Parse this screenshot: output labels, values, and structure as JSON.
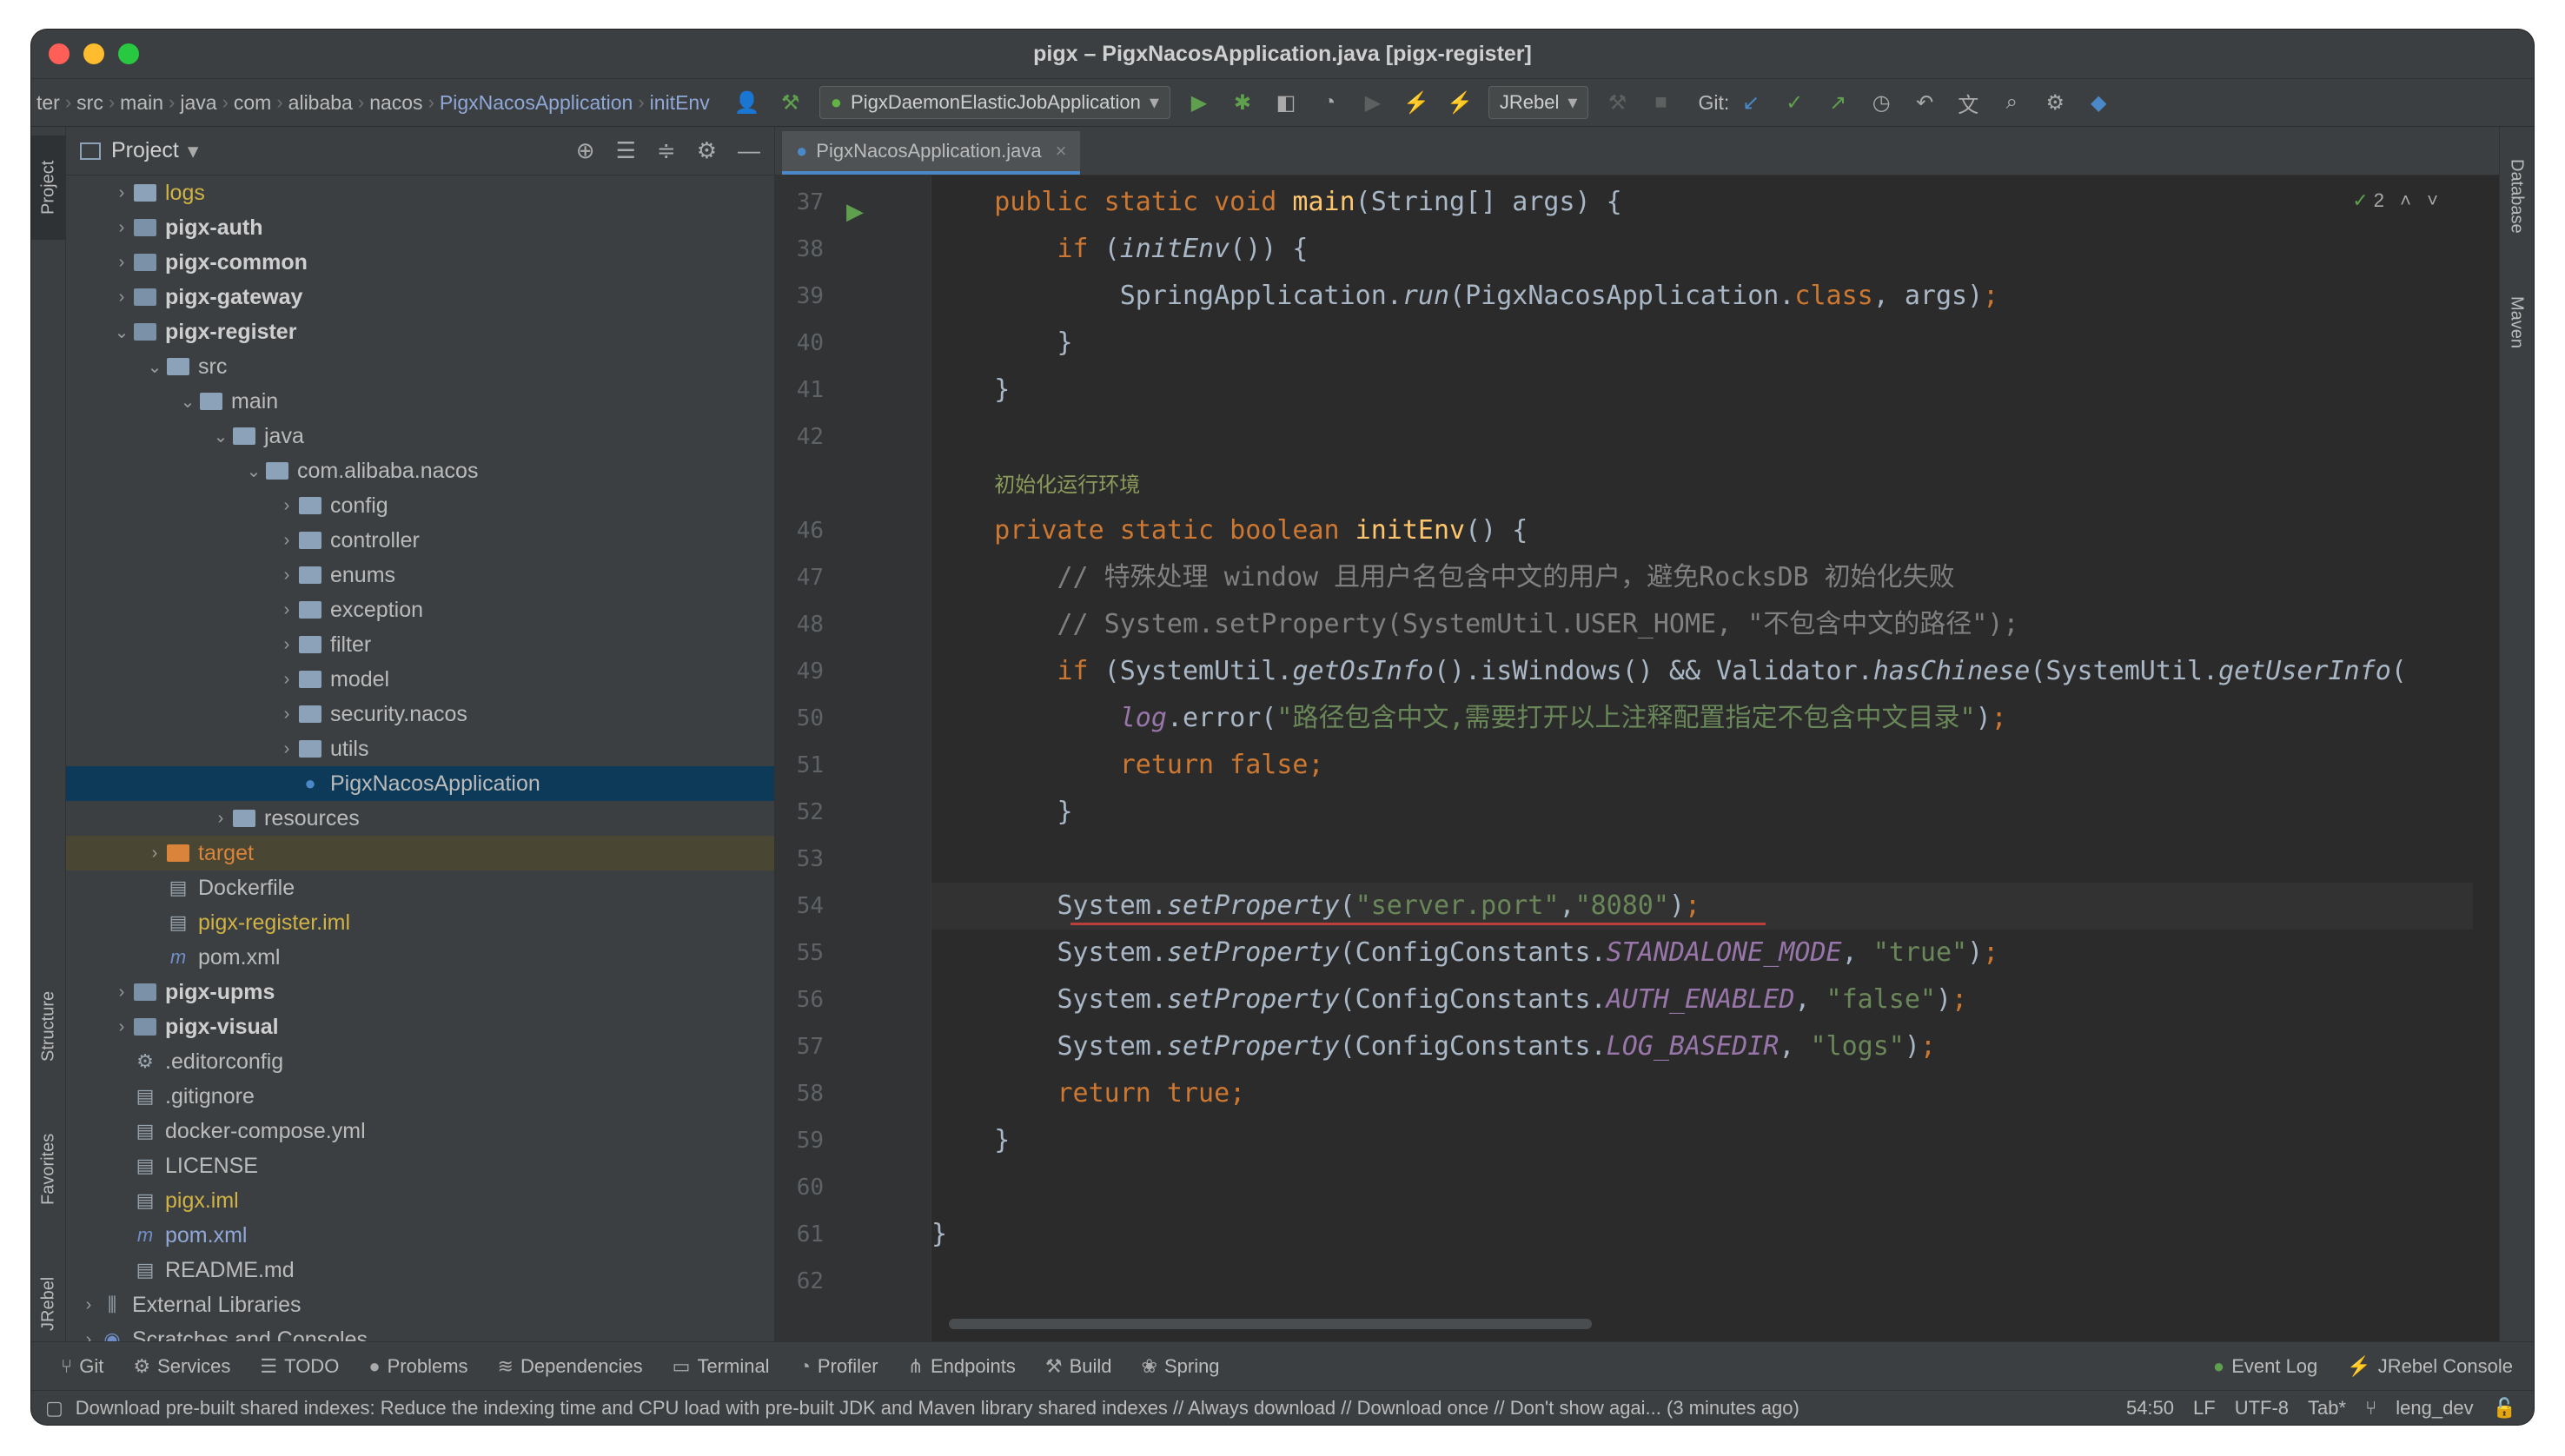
{
  "window": {
    "title": "pigx – PigxNacosApplication.java [pigx-register]"
  },
  "breadcrumbs": [
    "ter",
    "src",
    "main",
    "java",
    "com",
    "alibaba",
    "nacos",
    "PigxNacosApplication",
    "initEnv"
  ],
  "toolbar": {
    "run_config": "PigxDaemonElasticJobApplication",
    "jrebel": "JRebel",
    "git_label": "Git:"
  },
  "project_panel": {
    "title": "Project"
  },
  "tree": [
    {
      "label": "logs",
      "depth": 1,
      "kind": "folder",
      "style": "yellow",
      "chev": "›"
    },
    {
      "label": "pigx-auth",
      "depth": 1,
      "kind": "module",
      "style": "bold",
      "chev": "›"
    },
    {
      "label": "pigx-common",
      "depth": 1,
      "kind": "module",
      "style": "bold",
      "chev": "›"
    },
    {
      "label": "pigx-gateway",
      "depth": 1,
      "kind": "module",
      "style": "bold",
      "chev": "›"
    },
    {
      "label": "pigx-register",
      "depth": 1,
      "kind": "module",
      "style": "bold",
      "chev": "⌄"
    },
    {
      "label": "src",
      "depth": 2,
      "kind": "folder",
      "style": "",
      "chev": "⌄"
    },
    {
      "label": "main",
      "depth": 3,
      "kind": "folder",
      "style": "",
      "chev": "⌄"
    },
    {
      "label": "java",
      "depth": 4,
      "kind": "folder",
      "style": "",
      "chev": "⌄"
    },
    {
      "label": "com.alibaba.nacos",
      "depth": 5,
      "kind": "folder",
      "style": "",
      "chev": "⌄"
    },
    {
      "label": "config",
      "depth": 6,
      "kind": "folder",
      "style": "",
      "chev": "›"
    },
    {
      "label": "controller",
      "depth": 6,
      "kind": "folder",
      "style": "",
      "chev": "›"
    },
    {
      "label": "enums",
      "depth": 6,
      "kind": "folder",
      "style": "",
      "chev": "›"
    },
    {
      "label": "exception",
      "depth": 6,
      "kind": "folder",
      "style": "",
      "chev": "›"
    },
    {
      "label": "filter",
      "depth": 6,
      "kind": "folder",
      "style": "",
      "chev": "›"
    },
    {
      "label": "model",
      "depth": 6,
      "kind": "folder",
      "style": "",
      "chev": "›"
    },
    {
      "label": "security.nacos",
      "depth": 6,
      "kind": "folder",
      "style": "",
      "chev": "›"
    },
    {
      "label": "utils",
      "depth": 6,
      "kind": "folder",
      "style": "",
      "chev": "›"
    },
    {
      "label": "PigxNacosApplication",
      "depth": 6,
      "kind": "class",
      "style": "",
      "chev": "",
      "selected": true
    },
    {
      "label": "resources",
      "depth": 4,
      "kind": "folder",
      "style": "",
      "chev": "›"
    },
    {
      "label": "target",
      "depth": 2,
      "kind": "folder-orange",
      "style": "orangetxt",
      "chev": "›",
      "target": true
    },
    {
      "label": "Dockerfile",
      "depth": 2,
      "kind": "file",
      "style": "",
      "chev": ""
    },
    {
      "label": "pigx-register.iml",
      "depth": 2,
      "kind": "file",
      "style": "yellow",
      "chev": ""
    },
    {
      "label": "pom.xml",
      "depth": 2,
      "kind": "maven",
      "style": "",
      "chev": ""
    },
    {
      "label": "pigx-upms",
      "depth": 1,
      "kind": "module",
      "style": "bold",
      "chev": "›"
    },
    {
      "label": "pigx-visual",
      "depth": 1,
      "kind": "module",
      "style": "bold",
      "chev": "›"
    },
    {
      "label": ".editorconfig",
      "depth": 1,
      "kind": "gear",
      "style": "",
      "chev": ""
    },
    {
      "label": ".gitignore",
      "depth": 1,
      "kind": "file",
      "style": "",
      "chev": ""
    },
    {
      "label": "docker-compose.yml",
      "depth": 1,
      "kind": "file",
      "style": "",
      "chev": ""
    },
    {
      "label": "LICENSE",
      "depth": 1,
      "kind": "file",
      "style": "",
      "chev": ""
    },
    {
      "label": "pigx.iml",
      "depth": 1,
      "kind": "file",
      "style": "yellow",
      "chev": ""
    },
    {
      "label": "pom.xml",
      "depth": 1,
      "kind": "maven",
      "style": "bluetxt",
      "chev": ""
    },
    {
      "label": "README.md",
      "depth": 1,
      "kind": "file",
      "style": "",
      "chev": ""
    },
    {
      "label": "External Libraries",
      "depth": 0,
      "kind": "lib",
      "style": "",
      "chev": "›"
    },
    {
      "label": "Scratches and Consoles",
      "depth": 0,
      "kind": "scratch",
      "style": "",
      "chev": "›"
    }
  ],
  "editor": {
    "tab_label": "PigxNacosApplication.java",
    "inspection_count": "2",
    "lines": [
      {
        "n": "37",
        "html": "    <span class='kw'>public static void</span> <span class='fn'>main</span>(String[] args) {"
      },
      {
        "n": "38",
        "html": "        <span class='kw'>if</span> (<span class='it'>initEnv</span>()) {"
      },
      {
        "n": "39",
        "html": "            SpringApplication.<span class='it'>run</span>(PigxNacosApplication.<span class='kw'>class</span>, args)<span class='kw'>;</span>"
      },
      {
        "n": "40",
        "html": "        }"
      },
      {
        "n": "41",
        "html": "    }"
      },
      {
        "n": "42",
        "html": ""
      },
      {
        "n": "",
        "html": "    <span class='hint'>初始化运行环境</span>"
      },
      {
        "n": "46",
        "html": "    <span class='kw'>private static boolean</span> <span class='fn'>initEnv</span>() {"
      },
      {
        "n": "47",
        "html": "        <span class='cm'>// 特殊处理 window 且用户名包含中文的用户，避免RocksDB 初始化失败</span>"
      },
      {
        "n": "48",
        "html": "        <span class='cm'>// System.setProperty(SystemUtil.USER_HOME, \"不包含中文的路径\");</span>"
      },
      {
        "n": "49",
        "html": "        <span class='kw'>if</span> (SystemUtil.<span class='it'>getOsInfo</span>().isWindows() &amp;&amp; Validator.<span class='it'>hasChinese</span>(SystemUtil.<span class='it'>getUserInfo</span>("
      },
      {
        "n": "50",
        "html": "            <span class='cst'>log</span>.error(<span class='str'>\"路径包含中文,需要打开以上注释配置指定不包含中文目录\"</span>)<span class='kw'>;</span>"
      },
      {
        "n": "51",
        "html": "            <span class='kw'>return false;</span>"
      },
      {
        "n": "52",
        "html": "        }"
      },
      {
        "n": "53",
        "html": ""
      },
      {
        "n": "54",
        "html": "        System.<span class='it'>setProperty</span>(<span class='str'>\"server.port\"</span>,<span class='str'>\"8080\"</span>)<span class='kw'>;</span>"
      },
      {
        "n": "55",
        "html": "        System.<span class='it'>setProperty</span>(ConfigConstants.<span class='cst'>STANDALONE_MODE</span>, <span class='str'>\"true\"</span>)<span class='kw'>;</span>"
      },
      {
        "n": "56",
        "html": "        System.<span class='it'>setProperty</span>(ConfigConstants.<span class='cst'>AUTH_ENABLED</span>, <span class='str'>\"false\"</span>)<span class='kw'>;</span>"
      },
      {
        "n": "57",
        "html": "        System.<span class='it'>setProperty</span>(ConfigConstants.<span class='cst'>LOG_BASEDIR</span>, <span class='str'>\"logs\"</span>)<span class='kw'>;</span>"
      },
      {
        "n": "58",
        "html": "        <span class='kw'>return true;</span>"
      },
      {
        "n": "59",
        "html": "    }"
      },
      {
        "n": "60",
        "html": ""
      },
      {
        "n": "61",
        "html": "}"
      },
      {
        "n": "62",
        "html": ""
      }
    ]
  },
  "left_tabs": [
    "Project",
    "Structure",
    "Favorites",
    "JRebel"
  ],
  "right_tabs": [
    "Database",
    "Maven"
  ],
  "bottom_tabs": [
    "Git",
    "Services",
    "TODO",
    "Problems",
    "Dependencies",
    "Terminal",
    "Profiler",
    "Endpoints",
    "Build",
    "Spring"
  ],
  "bottom_right_tabs": [
    "Event Log",
    "JRebel Console"
  ],
  "status": {
    "message": "Download pre-built shared indexes: Reduce the indexing time and CPU load with pre-built JDK and Maven library shared indexes // Always download // Download once // Don't show agai... (3 minutes ago)",
    "position": "54:50",
    "line_sep": "LF",
    "encoding": "UTF-8",
    "indent": "Tab*",
    "branch": "leng_dev"
  }
}
